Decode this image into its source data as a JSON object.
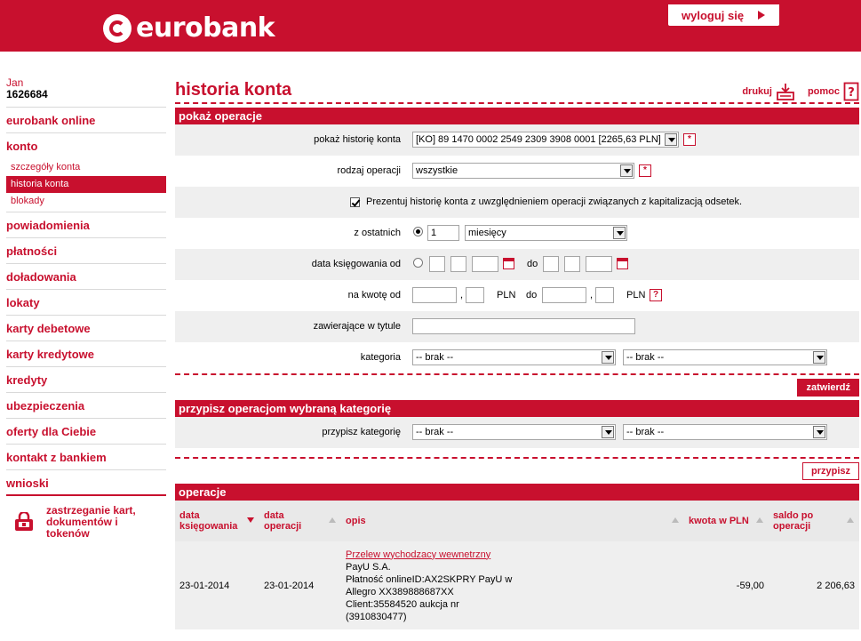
{
  "header": {
    "logo_text": "eurobank",
    "logout_label": "wyloguj się"
  },
  "user": {
    "name": "Jan",
    "id": "1626684"
  },
  "sidebar": {
    "online": "eurobank online",
    "konto": "konto",
    "konto_items": [
      "szczegóły konta",
      "historia konta",
      "blokady"
    ],
    "items": [
      "powiadomienia",
      "płatności",
      "doładowania",
      "lokaty",
      "karty debetowe",
      "karty kredytowe",
      "kredyty",
      "ubezpieczenia",
      "oferty dla Ciebie",
      "kontakt z bankiem",
      "wnioski"
    ],
    "block_text_1": "zastrzeganie kart,",
    "block_text_2": "dokumentów i",
    "block_text_3": "tokenów"
  },
  "page": {
    "title": "historia konta",
    "print": "drukuj",
    "help": "pomoc"
  },
  "filter": {
    "section_title": "pokaż operacje",
    "account_label": "pokaż historię konta",
    "account_value": "[KO] 89 1470 0002 2549 2309 3908 0001 [2265,63 PLN]",
    "type_label": "rodzaj operacji",
    "type_value": "wszystkie",
    "capitalization_text": "Prezentuj historię konta z uwzględnieniem operacji związanych z kapitalizacją odsetek.",
    "last_label": "z ostatnich",
    "last_value": "1",
    "last_unit": "miesięcy",
    "date_label": "data księgowania od",
    "date_to": "do",
    "amount_label": "na kwotę od",
    "comma": ",",
    "currency": "PLN",
    "amount_to": "do",
    "title_label": "zawierające w tytule",
    "category_label": "kategoria",
    "category_value_1": "-- brak --",
    "category_value_2": "-- brak --",
    "submit": "zatwierdź"
  },
  "assign": {
    "section_title": "przypisz operacjom wybraną kategorię",
    "label": "przypisz kategorię",
    "value_1": "-- brak --",
    "value_2": "-- brak --",
    "button": "przypisz"
  },
  "operations": {
    "section_title": "operacje",
    "columns": {
      "booking_1": "data",
      "booking_2": "księgowania",
      "op_1": "data",
      "op_2": "operacji",
      "desc": "opis",
      "amount": "kwota w PLN",
      "balance_1": "saldo po",
      "balance_2": "operacji"
    },
    "rows": [
      {
        "booking_date": "23-01-2014",
        "op_date": "23-01-2014",
        "desc_link": "Przelew wychodzacy wewnetrzny",
        "desc_1": "PayU S.A.",
        "desc_2": "Płatność onlineID:AX2SKPRY PayU w",
        "desc_3": "Allegro XX389888687XX",
        "desc_4": "Client:35584520 aukcja nr",
        "desc_5": "(3910830477)",
        "amount": "-59,00",
        "balance": "2 206,63"
      }
    ]
  },
  "colors": {
    "brand": "#c8102e",
    "row_bg": "#efefef"
  }
}
